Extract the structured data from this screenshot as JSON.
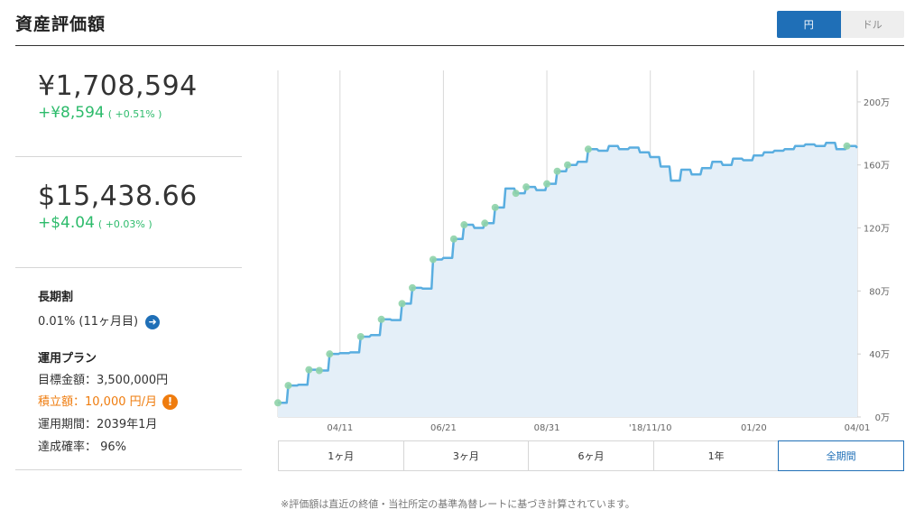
{
  "header": {
    "title": "資産評価額"
  },
  "currency_toggle": {
    "options": [
      "円",
      "ドル"
    ],
    "selected": "円"
  },
  "summary": {
    "jpy": {
      "value": "¥1,708,594",
      "delta": "+¥8,594",
      "delta_pct": "( +0.51% )"
    },
    "usd": {
      "value": "$15,438.66",
      "delta": "+$4.04",
      "delta_pct": "( +0.03% )"
    }
  },
  "long_term_discount": {
    "label": "長期割",
    "value": "0.01% (11ヶ月目)",
    "icon": "arrow-right-icon"
  },
  "plan": {
    "label": "運用プラン",
    "target": "目標金額：3,500,000円",
    "contribution": "積立額：10,000 円/月",
    "period": "運用期間：2039年1月",
    "probability": "達成確率： 96%",
    "warn_icon": "exclamation-icon",
    "warn_color": "#ef7c0e"
  },
  "chart_data": {
    "type": "area",
    "y_unit": "万",
    "ylim": [
      0,
      2200000
    ],
    "y_ticks": [
      "0万",
      "40万",
      "80万",
      "120万",
      "160万",
      "200万"
    ],
    "x_ticks": [
      "04/11",
      "06/21",
      "08/31",
      "'18/11/10",
      "01/20",
      "04/01"
    ],
    "grid": "vertical",
    "line_color": "#5aaee0",
    "fill_color": "#e4eff8",
    "marker_color": "#8fd3a8",
    "x": [
      "2017-03-01",
      "2017-03-08",
      "2017-03-15",
      "2017-03-22",
      "2017-03-29",
      "2017-04-05",
      "2017-04-11",
      "2017-04-18",
      "2017-04-25",
      "2017-05-02",
      "2017-05-09",
      "2017-05-16",
      "2017-05-23",
      "2017-05-30",
      "2017-06-06",
      "2017-06-13",
      "2017-06-21",
      "2017-06-28",
      "2017-07-05",
      "2017-07-12",
      "2017-07-19",
      "2017-07-26",
      "2017-08-02",
      "2017-08-09",
      "2017-08-16",
      "2017-08-23",
      "2017-08-31",
      "2017-09-07",
      "2017-09-14",
      "2017-09-21",
      "2017-09-28",
      "2017-10-05",
      "2017-10-12",
      "2017-10-19",
      "2017-10-26",
      "2017-11-02",
      "2017-11-10",
      "2017-11-17",
      "2017-11-24",
      "2017-12-01",
      "2017-12-08",
      "2017-12-15",
      "2017-12-22",
      "2017-12-29",
      "2018-01-05",
      "2018-01-12",
      "2018-01-20",
      "2018-01-27",
      "2018-02-03",
      "2018-02-10",
      "2018-02-17",
      "2018-02-24",
      "2018-03-03",
      "2018-03-10",
      "2018-03-17",
      "2018-03-24",
      "2018-04-01"
    ],
    "values": [
      90000,
      200000,
      205000,
      300000,
      295000,
      400000,
      405000,
      410000,
      510000,
      520000,
      620000,
      615000,
      720000,
      820000,
      815000,
      1000000,
      1010000,
      1130000,
      1220000,
      1200000,
      1230000,
      1330000,
      1450000,
      1420000,
      1460000,
      1440000,
      1480000,
      1560000,
      1600000,
      1620000,
      1700000,
      1690000,
      1720000,
      1700000,
      1710000,
      1680000,
      1650000,
      1590000,
      1500000,
      1570000,
      1540000,
      1580000,
      1620000,
      1600000,
      1640000,
      1630000,
      1660000,
      1680000,
      1690000,
      1700000,
      1720000,
      1730000,
      1720000,
      1740000,
      1700000,
      1720000,
      1708594
    ],
    "markers": [
      0,
      1,
      3,
      4,
      5,
      8,
      10,
      12,
      13,
      15,
      17,
      18,
      20,
      21,
      23,
      24,
      26,
      27,
      28,
      30,
      55
    ]
  },
  "period_buttons": [
    "1ヶ月",
    "3ヶ月",
    "6ヶ月",
    "1年",
    "全期間"
  ],
  "period_selected": "全期間",
  "footnote": "※評価額は直近の終値・当社所定の基準為替レートに基づき計算されています。"
}
